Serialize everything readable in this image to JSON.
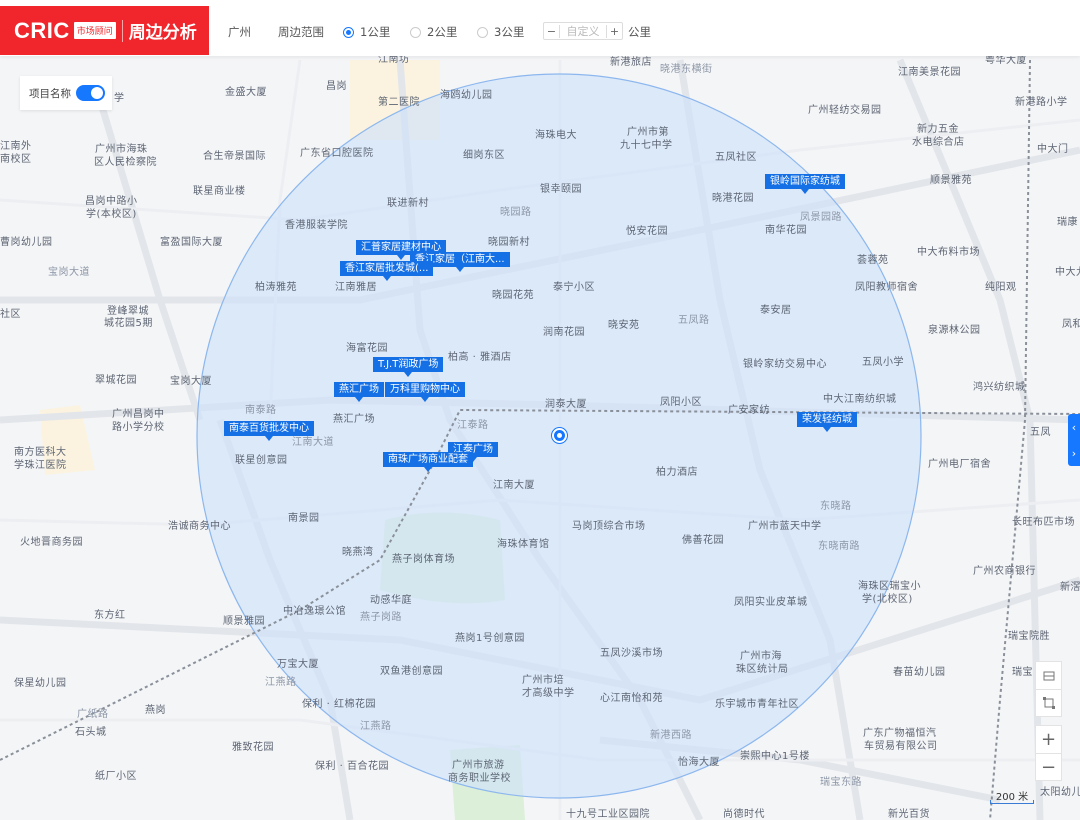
{
  "header": {
    "logo": {
      "brand": "CRIC",
      "tag": "市场顾问",
      "product": "周边分析"
    },
    "city": "广州",
    "range_label": "周边范围",
    "range_options": [
      {
        "label": "1公里",
        "selected": true
      },
      {
        "label": "2公里",
        "selected": false
      },
      {
        "label": "3公里",
        "selected": false
      }
    ],
    "custom": {
      "minus": "−",
      "placeholder": "自定义",
      "plus": "+",
      "unit": "公里"
    }
  },
  "toggle": {
    "label": "项目名称",
    "on": true
  },
  "colors": {
    "brand_red": "#f0262c",
    "accent_blue": "#1677ff",
    "marker_blue": "#1570e6",
    "circle_fill": "#cfe2fb"
  },
  "markers": [
    "汇普家居建材中心",
    "香江家居（江南大...",
    "香江家居批发城(...",
    "T.J.T润政广场",
    "燕汇广场",
    "万科里购物中心",
    "南泰百货批发中心",
    "江泰广场",
    "南珠广场商业配套",
    "银岭国际家纺城",
    "荣发轻纺城"
  ],
  "map_labels": [
    "江南坊",
    "新港旅店",
    "晓港东横街",
    "江南美景花园",
    "粤华大厦",
    "学",
    "金盛大厦",
    "昌岗",
    "第二医院",
    "海鸥幼儿园",
    "新港路小学",
    "广州轻纺交易园",
    "海珠电大",
    "广州市第",
    "九十七中学",
    "细岗东区",
    "五凤社区",
    "新力五金",
    "水电综合店",
    "中大门",
    "广州市海珠",
    "区人民检察院",
    "江南外",
    "南校区",
    "合生帝景国际",
    "广东省口腔医院",
    "顺景雅苑",
    "银幸颐园",
    "联星商业楼",
    "联进新村",
    "晓园路",
    "晓港花园",
    "凤景园路",
    "昌岗中路小",
    "学(本校区)",
    "香港服装学院",
    "悦安花园",
    "南华花园",
    "瑞康",
    "富盈国际大厦",
    "中大布料市场",
    "晓园新村",
    "曹岗幼儿园",
    "宝岗大道",
    "荟蓉苑",
    "柏涛雅苑",
    "江南雅居",
    "泰宁小区",
    "凤阳教师宿舍",
    "纯阳观",
    "中大九",
    "晓园花苑",
    "登峰翠城",
    "城花园5期",
    "社区",
    "泰安居",
    "润南花园",
    "晓安苑",
    "五凤路",
    "泉源林公园",
    "凤和",
    "海富花园",
    "柏高 · 雅酒店",
    "银岭家纺交易中心",
    "五凤小学",
    "翠城花园",
    "宝岗大厦",
    "鸿兴纺织城",
    "中大江南纺织城",
    "广州昌岗中",
    "路小学分校",
    "南泰路",
    "燕汇广场",
    "润泰大厦",
    "凤阳小区",
    "广安家纺",
    "江泰路",
    "五凤",
    "南方医科大",
    "学珠江医院",
    "联星创意园",
    "广州电厂宿舍",
    "柏力酒店",
    "江南大厦",
    "南景园",
    "马岗顶综合市场",
    "广州市蓝天中学",
    "长旺布匹市场",
    "浩诚商务中心",
    "晓燕湾",
    "火地晋商务园",
    "燕子岗体育场",
    "海珠体育馆",
    "佛善花园",
    "广州农商银行",
    "海珠区瑞宝小",
    "学(北校区)",
    "新滘",
    "东晓南路",
    "动感华庭",
    "凤阳实业皮革城",
    "东方红",
    "中冶逸璟公馆",
    "顺景雅园",
    "燕子岗路",
    "燕岗1号创意园",
    "瑞宝院胜",
    "万宝大厦",
    "双鱼港创意园",
    "五凤沙溪市场",
    "广州市海",
    "珠区统计局",
    "春苗幼儿园",
    "瑞宝",
    "保星幼儿园",
    "江燕路",
    "广州市培",
    "才高级中学",
    "心江南怡和苑",
    "燕岗",
    "广纸路",
    "保利 · 红棉花园",
    "乐宇城市青年社区",
    "广东广物福恒汽",
    "车贸易有限公司",
    "石头城",
    "新港西路",
    "雅致花园",
    "怡海大厦",
    "广州市旅游",
    "商务职业学校",
    "保利 · 百合花园",
    "纸厂小区",
    "崇熙中心1号楼",
    "瑞宝东路",
    "十九号工业区园院",
    "尚德时代",
    "新光百货",
    "太阳幼儿",
    "江南大道",
    "东晓路",
    "江燕路"
  ],
  "controls": {
    "zoom_in": "+",
    "zoom_out": "−",
    "side_prev": "‹",
    "side_next": "›"
  },
  "scale": "200 米"
}
